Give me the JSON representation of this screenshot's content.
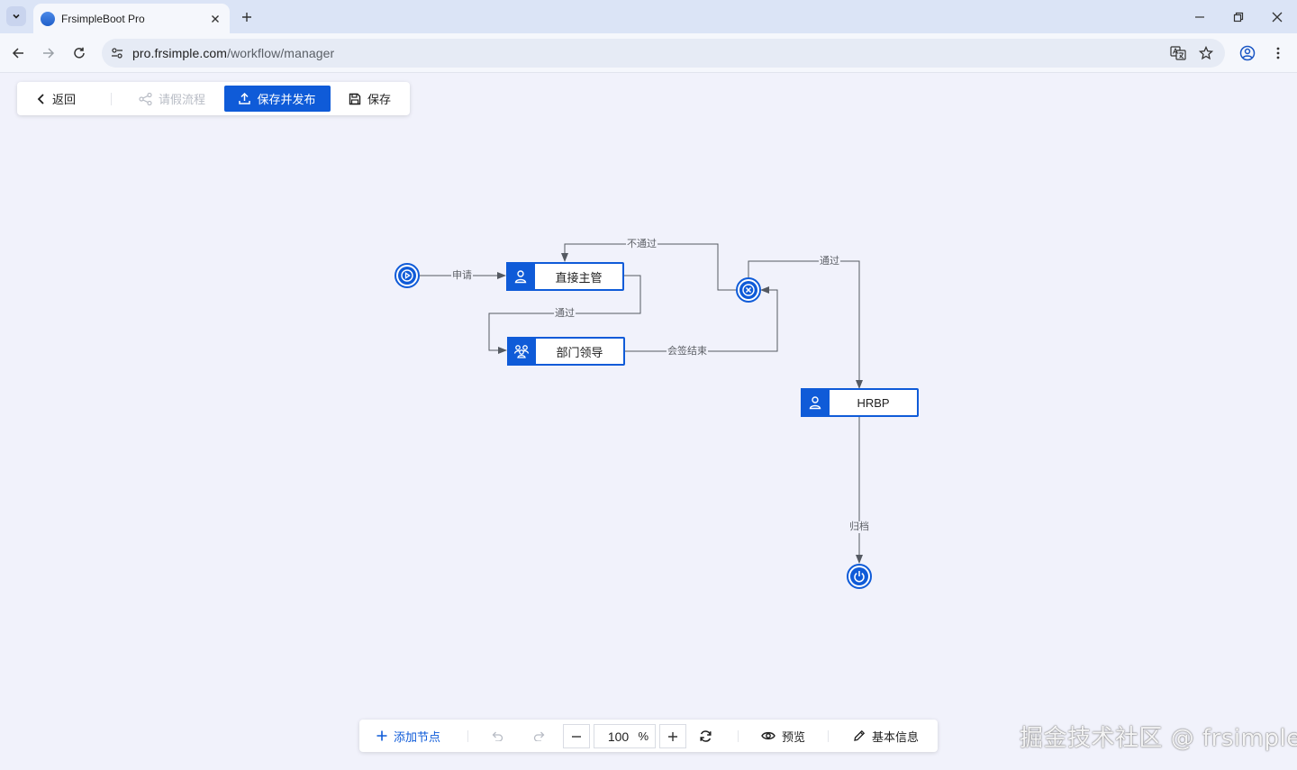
{
  "browser": {
    "tab_title": "FrsimpleBoot Pro",
    "url_host": "pro.frsimple.com",
    "url_path": "/workflow/manager"
  },
  "editor_toolbar": {
    "back_label": "返回",
    "flow_name": "请假流程",
    "publish_label": "保存并发布",
    "save_label": "保存"
  },
  "workflow": {
    "nodes": {
      "direct_manager": "直接主管",
      "dept_leader": "部门领导",
      "hrbp": "HRBP"
    },
    "edge_labels": {
      "apply": "申请",
      "reject": "不通过",
      "pass_to_leader": "通过",
      "countersign_end": "会签结束",
      "pass_to_hrbp": "通过",
      "archive": "归档"
    }
  },
  "bottom_toolbar": {
    "add_node_label": "添加节点",
    "zoom_value": "100",
    "zoom_unit": "%",
    "preview_label": "预览",
    "basic_info_label": "基本信息"
  },
  "watermark": "掘金技术社区 @ frsimple",
  "colors": {
    "primary": "#0f5bd8",
    "canvas_bg": "#f1f2fb",
    "edge": "#555a62"
  }
}
